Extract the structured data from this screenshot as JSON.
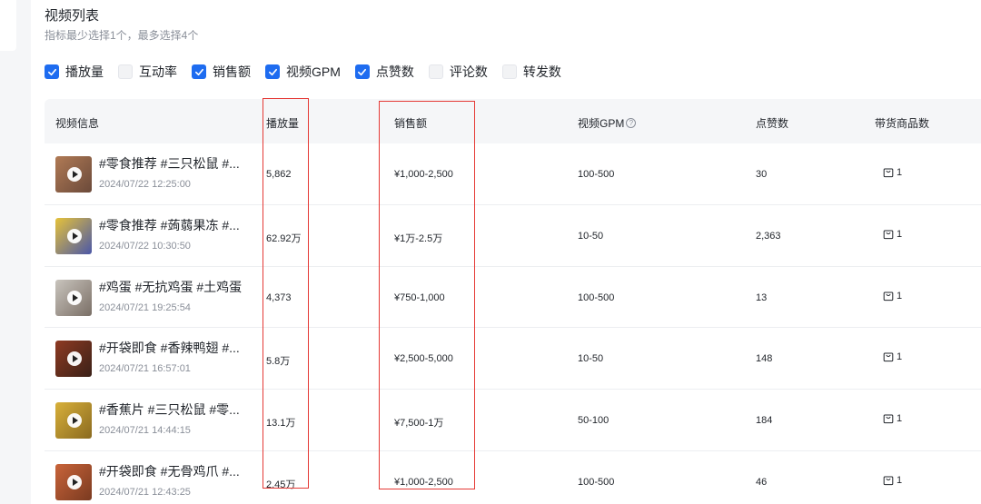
{
  "section": {
    "title": "视频列表",
    "subtitle": "指标最少选择1个，最多选择4个"
  },
  "metrics": [
    {
      "label": "播放量",
      "checked": true
    },
    {
      "label": "互动率",
      "checked": false
    },
    {
      "label": "销售额",
      "checked": true
    },
    {
      "label": "视频GPM",
      "checked": true
    },
    {
      "label": "点赞数",
      "checked": true
    },
    {
      "label": "评论数",
      "checked": false
    },
    {
      "label": "转发数",
      "checked": false
    }
  ],
  "table": {
    "headers": {
      "video_info": "视频信息",
      "plays": "播放量",
      "sales": "销售额",
      "gpm": "视频GPM",
      "likes": "点赞数",
      "goods": "带货商品数"
    },
    "rows": [
      {
        "title": "#零食推荐 #三只松鼠 #...",
        "date": "2024/07/22 12:25:00",
        "plays": "5,862",
        "sales": "¥1,000-2,500",
        "gpm": "100-500",
        "likes": "30",
        "goods": "1",
        "thumb_colors": [
          "#b07a55",
          "#6b4a3a"
        ]
      },
      {
        "title": "#零食推荐 #蒟蒻果冻 #...",
        "date": "2024/07/22 10:30:50",
        "plays": "62.92万",
        "sales": "¥1万-2.5万",
        "gpm": "10-50",
        "likes": "2,363",
        "goods": "1",
        "thumb_colors": [
          "#e6c23a",
          "#4a57a8"
        ]
      },
      {
        "title": "#鸡蛋 #无抗鸡蛋 #土鸡蛋",
        "date": "2024/07/21 19:25:54",
        "plays": "4,373",
        "sales": "¥750-1,000",
        "gpm": "100-500",
        "likes": "13",
        "goods": "1",
        "thumb_colors": [
          "#c9c4bd",
          "#7a6f66"
        ]
      },
      {
        "title": "#开袋即食 #香辣鸭翅 #...",
        "date": "2024/07/21 16:57:01",
        "plays": "5.8万",
        "sales": "¥2,500-5,000",
        "gpm": "10-50",
        "likes": "148",
        "goods": "1",
        "thumb_colors": [
          "#8e3a22",
          "#3a2118"
        ]
      },
      {
        "title": "#香蕉片 #三只松鼠 #零...",
        "date": "2024/07/21 14:44:15",
        "plays": "13.1万",
        "sales": "¥7,500-1万",
        "gpm": "50-100",
        "likes": "184",
        "goods": "1",
        "thumb_colors": [
          "#d8b03a",
          "#8a6a20"
        ]
      },
      {
        "title": "#开袋即食 #无骨鸡爪 #...",
        "date": "2024/07/21 12:43:25",
        "plays": "2.45万",
        "sales": "¥1,000-2,500",
        "gpm": "100-500",
        "likes": "46",
        "goods": "1",
        "thumb_colors": [
          "#c9643a",
          "#7a3a20"
        ]
      }
    ]
  },
  "colors": {
    "accent": "#1e6cf0",
    "highlight": "#e53935"
  },
  "icons": {
    "play": "play-icon",
    "help": "question-circle-icon",
    "goods": "shopping-bag-icon",
    "check": "check-icon"
  }
}
